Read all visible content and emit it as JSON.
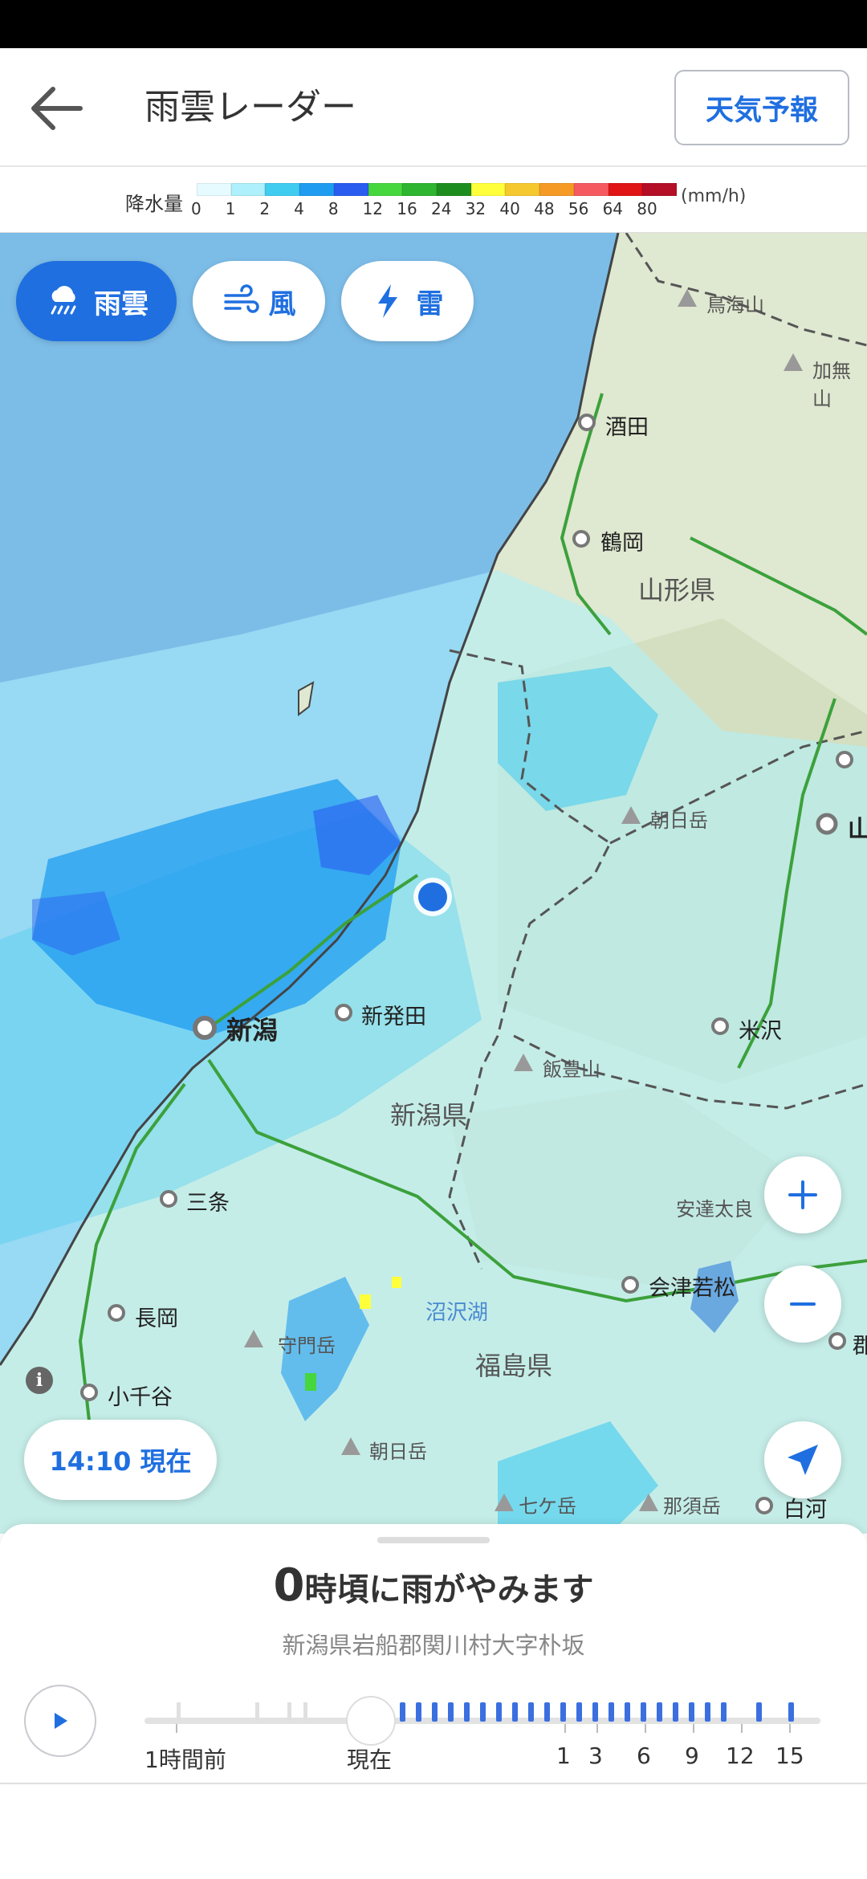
{
  "header": {
    "title": "雨雲レーダー",
    "back_icon": "arrow-left-icon",
    "forecast_button": "天気予報"
  },
  "legend": {
    "title": "降水量",
    "unit": "(mm/h)",
    "labels": [
      "0",
      "1",
      "2",
      "4",
      "8",
      "12",
      "16",
      "24",
      "32",
      "40",
      "48",
      "56",
      "64",
      "80"
    ],
    "colors": [
      "#e6fbff",
      "#aef0fb",
      "#40cbf0",
      "#1f9cf0",
      "#2a5cf0",
      "#46d63e",
      "#2fb530",
      "#1e8d20",
      "#ffff3c",
      "#f5c830",
      "#f59a25",
      "#f55a60",
      "#e01515",
      "#b40f26"
    ]
  },
  "layers": [
    {
      "label": "雨雲",
      "icon": "rain-cloud-icon",
      "active": true
    },
    {
      "label": "風",
      "icon": "wind-icon",
      "active": false
    },
    {
      "label": "雷",
      "icon": "lightning-icon",
      "active": false
    }
  ],
  "map": {
    "labels": {
      "chokaisan": "鳥海山",
      "kaburisan": "加無山",
      "sakata": "酒田",
      "tsuruoka": "鶴岡",
      "yamagata_pref": "山形県",
      "asahidake": "朝日岳",
      "yama": "山",
      "niigata": "新潟",
      "shibata": "新発田",
      "yonezawa": "米沢",
      "iidesan": "飯豊山",
      "niigata_pref": "新潟県",
      "sanjo": "三条",
      "adatara": "安達太良",
      "aizu": "会津若松",
      "nagaoka": "長岡",
      "numazawa": "沼沢湖",
      "fukushima_pref": "福島県",
      "ojiya": "小千谷",
      "gun": "郡",
      "asahidake2": "朝日岳",
      "nanagatake": "七ケ岳",
      "nasudake": "那須岳",
      "shirakawa": "白河",
      "monzen": "守門岳"
    }
  },
  "controls": {
    "zoom_in_icon": "plus-icon",
    "zoom_out_icon": "minus-icon",
    "locate_icon": "navigation-arrow-icon",
    "info_icon": "info-icon"
  },
  "time_chip": "14:10 現在",
  "sheet": {
    "headline_num": "0",
    "headline_text": "時頃に雨がやみます",
    "location": "新潟県岩船郡関川村大字朴坂",
    "play_icon": "play-icon",
    "timeline_labels": [
      "1時間前",
      "現在",
      "1",
      "3",
      "6",
      "9",
      "12",
      "15"
    ]
  },
  "colors": {
    "accent": "#1f6fe0",
    "sea": "#7cbde8",
    "land": "#dfe8d0"
  }
}
